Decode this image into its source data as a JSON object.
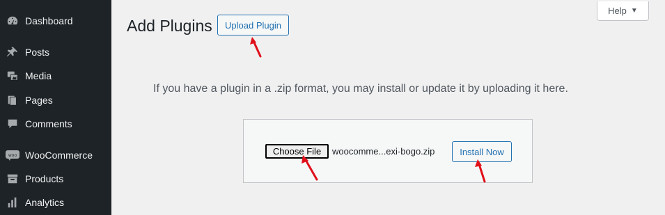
{
  "sidebar": {
    "items": [
      {
        "label": "Dashboard",
        "icon": "dashboard-icon"
      },
      {
        "label": "Posts",
        "icon": "pin-icon"
      },
      {
        "label": "Media",
        "icon": "media-icon"
      },
      {
        "label": "Pages",
        "icon": "pages-icon"
      },
      {
        "label": "Comments",
        "icon": "comment-icon"
      },
      {
        "label": "WooCommerce",
        "icon": "woo-icon"
      },
      {
        "label": "Products",
        "icon": "archive-icon"
      },
      {
        "label": "Analytics",
        "icon": "bar-chart-icon"
      }
    ]
  },
  "header": {
    "title": "Add Plugins",
    "upload_label": "Upload Plugin",
    "help_label": "Help",
    "help_caret": "▼"
  },
  "upload": {
    "description": "If you have a plugin in a .zip format, you may install or update it by uploading it here.",
    "choose_label": "Choose File",
    "file_name": "woocomme...exi-bogo.zip",
    "install_label": "Install Now"
  },
  "colors": {
    "sidebar_bg": "#1d2327",
    "accent": "#2271b1",
    "annotation_arrow": "#e0101a",
    "page_bg": "#f0f0f1"
  }
}
